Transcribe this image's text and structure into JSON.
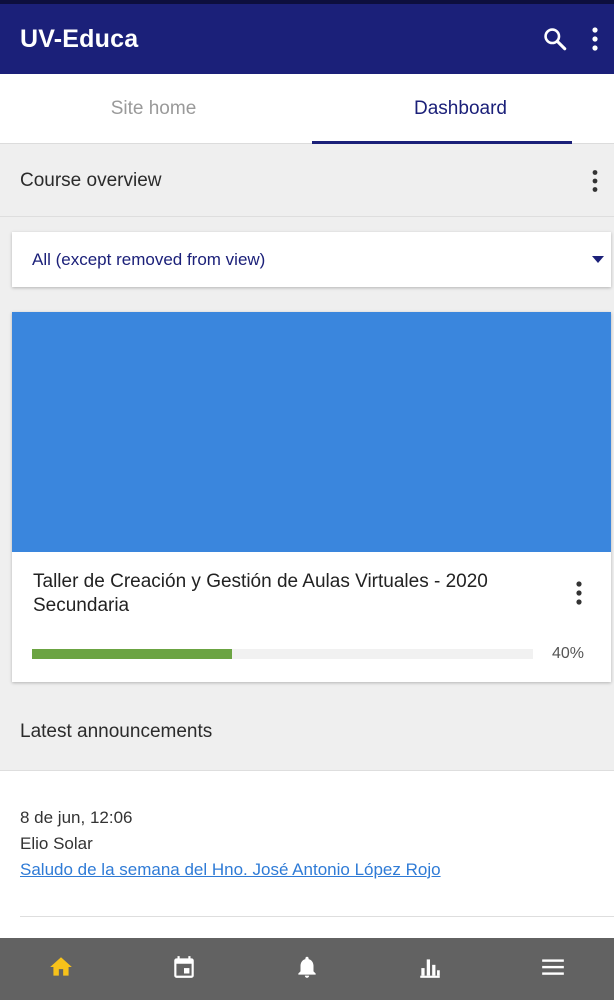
{
  "header": {
    "title": "UV-Educa",
    "search_icon": "search-icon",
    "more_icon": "more-vertical-icon"
  },
  "tabs": [
    {
      "label": "Site home",
      "active": false
    },
    {
      "label": "Dashboard",
      "active": true
    }
  ],
  "course_overview": {
    "title": "Course overview",
    "more_icon": "more-vertical-icon",
    "filter": {
      "selected": "All (except removed from view)"
    },
    "courses": [
      {
        "title": "Taller de Creación y Gestión de Aulas Virtuales - 2020 Secundaria",
        "progress_percent": 40,
        "progress_label": "40%",
        "image_color": "#3a86dd"
      }
    ]
  },
  "announcements": {
    "title": "Latest announcements",
    "items": [
      {
        "date": "8 de jun, 12:06",
        "author": "Elio Solar",
        "link_text": "Saludo de la semana del Hno. José Antonio López Rojo"
      }
    ]
  },
  "bottom_nav": [
    {
      "icon": "home-icon",
      "active": true
    },
    {
      "icon": "calendar-icon",
      "active": false
    },
    {
      "icon": "bell-icon",
      "active": false
    },
    {
      "icon": "grades-chart-icon",
      "active": false
    },
    {
      "icon": "menu-icon",
      "active": false
    }
  ],
  "colors": {
    "primary": "#1b2079",
    "progress": "#6ba442",
    "course_image": "#3a86dd",
    "link": "#2f7bd6",
    "nav_active": "#f7c21a",
    "bottom_nav_bg": "#626262"
  }
}
